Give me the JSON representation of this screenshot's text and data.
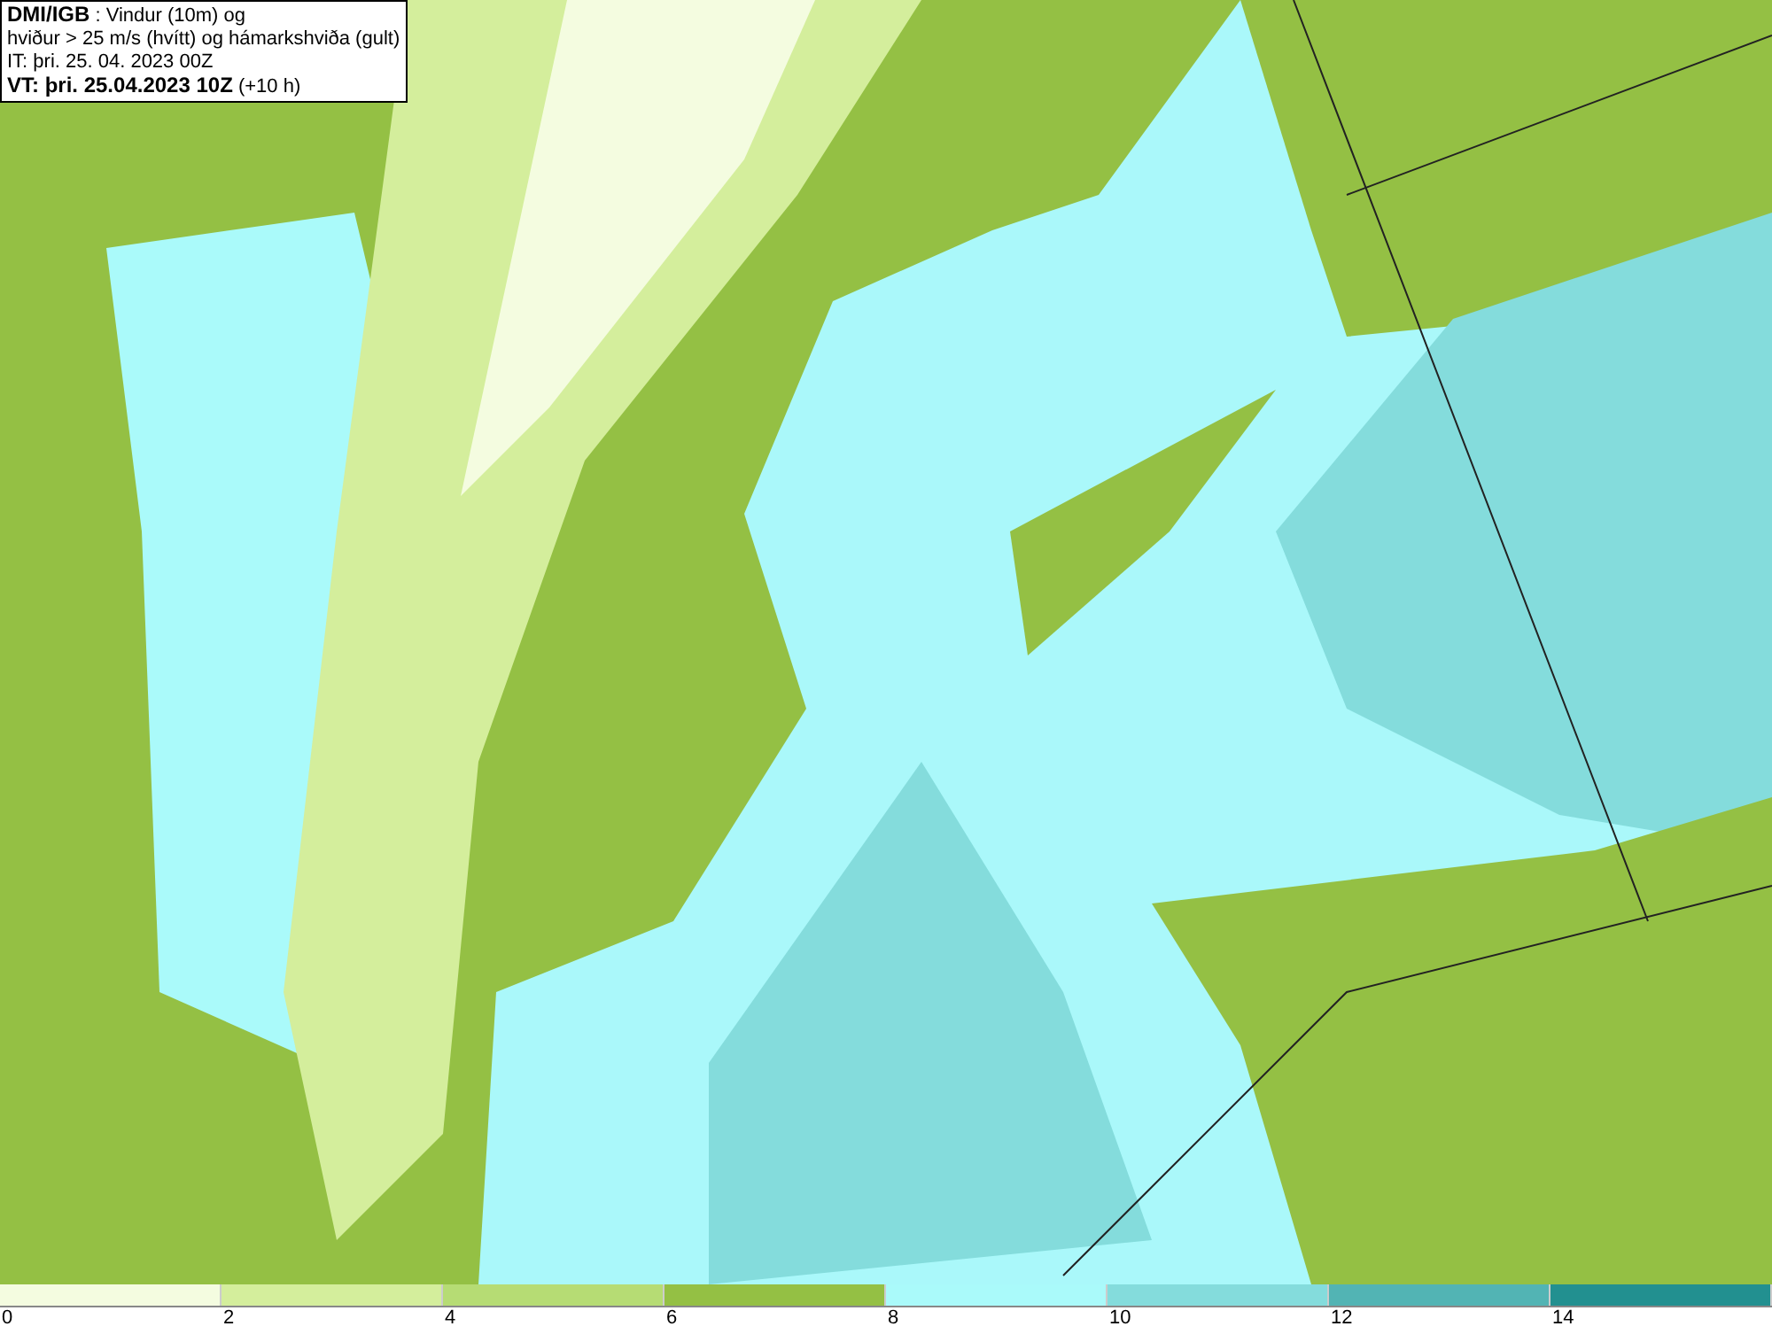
{
  "legend": {
    "lines": [
      "**DMI/IGB** : Vindur (10m) og",
      "hviður > 25 m/s (hvítt) og hámarkshviða (gult)",
      "IT: þri. 25. 04. 2023 00Z",
      "**VT: þri. 25.04.2023 10Z** (+10 h)"
    ]
  },
  "colorbar": {
    "bins": [
      {
        "color": "#f4fce0"
      },
      {
        "color": "#d4ee9c"
      },
      {
        "color": "#b6dc74"
      },
      {
        "color": "#94c044"
      },
      {
        "color": "#aafafa"
      },
      {
        "color": "#84dcdc"
      },
      {
        "color": "#52b4b4"
      },
      {
        "color": "#229090"
      }
    ],
    "ticks": [
      "0",
      "2",
      "4",
      "6",
      "8",
      "10",
      "12",
      "14"
    ]
  }
}
